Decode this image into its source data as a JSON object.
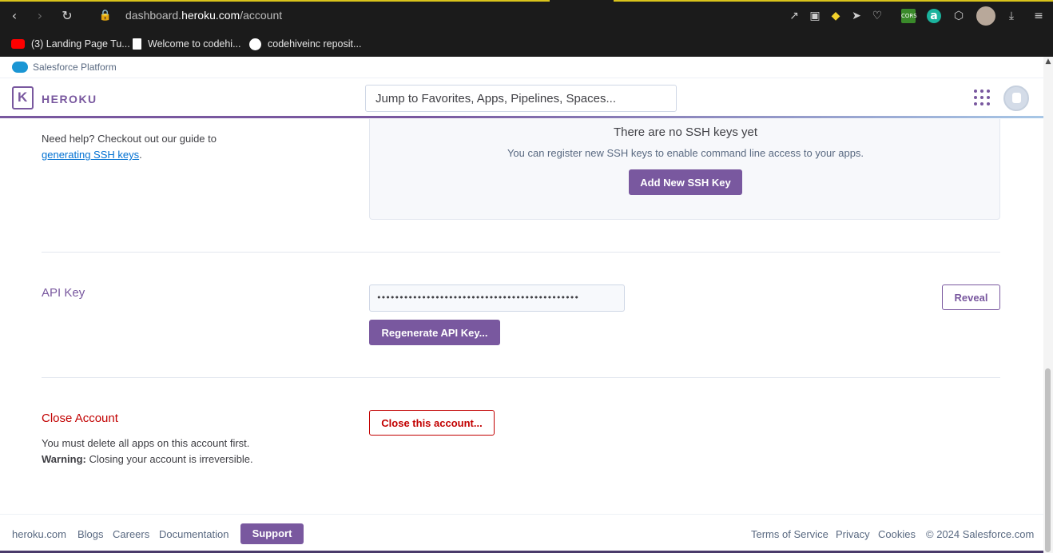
{
  "browser": {
    "url_prefix": "dashboard.",
    "url_domain": "heroku.com",
    "url_path": "/account",
    "bookmarks": [
      {
        "label": "(3) Landing Page Tu...",
        "icon": "youtube-icon",
        "color": "#ff0000"
      },
      {
        "label": "Welcome to codehi...",
        "icon": "document-icon",
        "color": "#ffffff"
      },
      {
        "label": "codehiveinc reposit...",
        "icon": "github-icon",
        "color": "#ffffff"
      }
    ]
  },
  "platform": {
    "label": "Salesforce Platform"
  },
  "header": {
    "logo_letter": "K",
    "logo_text": "HEROKU",
    "search_placeholder": "Jump to Favorites, Apps, Pipelines, Spaces..."
  },
  "ssh": {
    "help_text": "Need help? Checkout out our guide to",
    "help_link": "generating SSH keys",
    "help_end": ".",
    "empty_title": "There are no SSH keys yet",
    "empty_sub": "You can register new SSH keys to enable command line access to your apps.",
    "add_button": "Add New SSH Key"
  },
  "api": {
    "title": "API Key",
    "masked_value": "•••••••••••••••••••••••••••••••••••••••••••••",
    "reveal_button": "Reveal",
    "regenerate_button": "Regenerate API Key..."
  },
  "close_account": {
    "title": "Close Account",
    "line1": "You must delete all apps on this account first.",
    "warning_label": "Warning:",
    "warning_text": " Closing your account is irreversible.",
    "button": "Close this account..."
  },
  "footer": {
    "links_left": [
      "heroku.com",
      "Blogs",
      "Careers",
      "Documentation"
    ],
    "support": "Support",
    "links_right": [
      "Terms of Service",
      "Privacy",
      "Cookies",
      "© 2024 Salesforce.com"
    ]
  },
  "colors": {
    "brand": "#79589f",
    "danger": "#c20000",
    "link": "#0070d2"
  }
}
